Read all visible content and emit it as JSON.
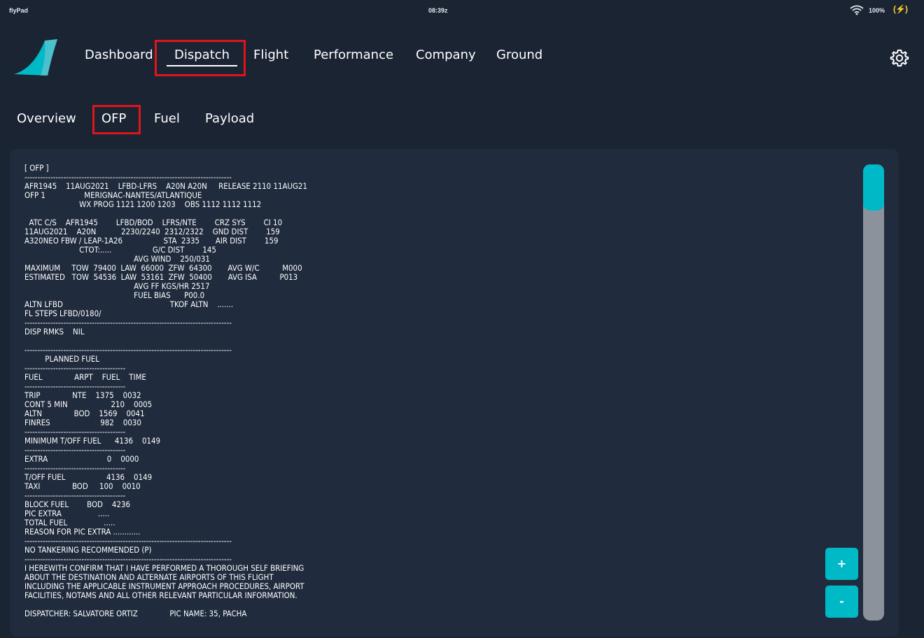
{
  "status_bar": {
    "app_name": "flyPad",
    "time": "08:39z",
    "battery": "100%",
    "charging_icon": "(⚡)"
  },
  "nav": {
    "items": [
      "Dashboard",
      "Dispatch",
      "Flight",
      "Performance",
      "Company",
      "Ground"
    ],
    "active": "Dispatch"
  },
  "subnav": {
    "tabs": [
      "Overview",
      "OFP",
      "Fuel",
      "Payload"
    ],
    "active": "OFP"
  },
  "ofp": {
    "lines": [
      "[ OFP ]",
      "--------------------------------------------------------------------------------",
      "AFR1945    11AUG2021    LFBD-LFRS    A20N A20N     RELEASE 2110 11AUG21",
      "OFP 1                 MERIGNAC-NANTES/ATLANTIQUE",
      "                        WX PROG 1121 1200 1203    OBS 1112 1112 1112",
      "",
      "  ATC C/S    AFR1945        LFBD/BOD    LFRS/NTE        CRZ SYS        CI 10",
      "11AUG2021    A20N           2230/2240  2312/2322    GND DIST        159",
      "A320NEO FBW / LEAP-1A26                  STA  2335       AIR DIST        159",
      "                        CTOT:.....                  G/C DIST        145",
      "                                                AVG WIND    250/031",
      "MAXIMUM     TOW  79400  LAW  66000  ZFW  64300       AVG W/C          M000",
      "ESTIMATED   TOW  54536  LAW  53161  ZFW  50400       AVG ISA          P013",
      "                                                AVG FF KGS/HR 2517",
      "                                                FUEL BIAS      P00.0",
      "ALTN LFBD                                               TKOF ALTN    .......",
      "FL STEPS LFBD/0180/",
      "--------------------------------------------------------------------------------",
      "DISP RMKS    NIL",
      "",
      "--------------------------------------------------------------------------------",
      "         PLANNED FUEL",
      "---------------------------------------",
      "FUEL              ARPT    FUEL    TIME",
      "---------------------------------------",
      "TRIP              NTE    1375    0032",
      "CONT 5 MIN                   210    0005",
      "ALTN              BOD    1569    0041",
      "FINRES                      982    0030",
      "---------------------------------------",
      "MINIMUM T/OFF FUEL      4136    0149",
      "---------------------------------------",
      "EXTRA                          0    0000",
      "---------------------------------------",
      "T/OFF FUEL                  4136    0149",
      "TAXI              BOD     100    0010",
      "---------------------------------------",
      "BLOCK FUEL        BOD    4236",
      "PIC EXTRA                .....",
      "TOTAL FUEL                .....",
      "REASON FOR PIC EXTRA ............",
      "--------------------------------------------------------------------------------",
      "NO TANKERING RECOMMENDED (P)",
      "--------------------------------------------------------------------------------",
      "I HEREWITH CONFIRM THAT I HAVE PERFORMED A THOROUGH SELF BRIEFING",
      "ABOUT THE DESTINATION AND ALTERNATE AIRPORTS OF THIS FLIGHT",
      "INCLUDING THE APPLICABLE INSTRUMENT APPROACH PROCEDURES, AIRPORT",
      "FACILITIES, NOTAMS AND ALL OTHER RELEVANT PARTICULAR INFORMATION.",
      "",
      "DISPATCHER: SALVATORE ORTIZ              PIC NAME: 35, PACHA"
    ]
  },
  "zoom": {
    "in_label": "+",
    "out_label": "-"
  },
  "colors": {
    "accent": "#00b9c7",
    "highlight": "#e0141b",
    "background": "#1b2433",
    "panel": "#202b3d"
  },
  "icons": {
    "logo": "flybywire-logo-icon",
    "settings": "gear-icon",
    "wifi": "wifi-icon",
    "battery": "battery-charging-icon"
  }
}
